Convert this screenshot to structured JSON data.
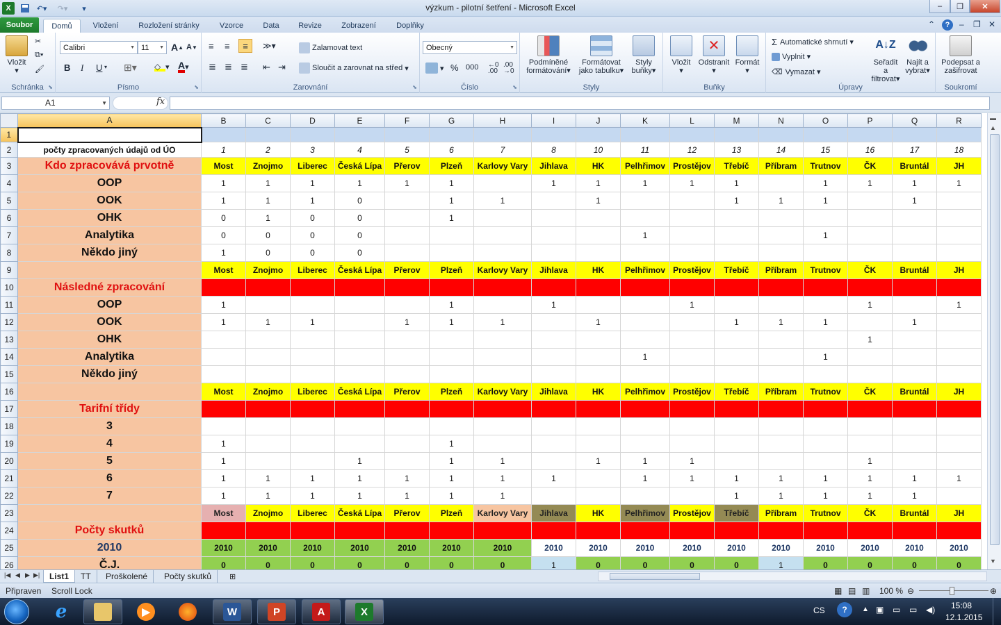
{
  "window": {
    "title": "výzkum - pilotní šetření  -  Microsoft Excel",
    "controls": {
      "minimize": "–",
      "restore": "❐",
      "close": "✕"
    }
  },
  "ribbon_tabs": [
    "Soubor",
    "Domů",
    "Vložení",
    "Rozložení stránky",
    "Vzorce",
    "Data",
    "Revize",
    "Zobrazení",
    "Doplňky"
  ],
  "ribbon": {
    "clipboard": {
      "paste": "Vložit",
      "group": "Schránka"
    },
    "font": {
      "name": "Calibri",
      "size": "11",
      "bold": "B",
      "italic": "I",
      "underline": "U",
      "group": "Písmo",
      "grow": "A",
      "shrink": "A"
    },
    "alignment": {
      "wrap": "Zalamovat text",
      "merge": "Sloučit a zarovnat na střed",
      "group": "Zarovnání"
    },
    "number": {
      "format": "Obecný",
      "percent": "%",
      "thousands": "000",
      "group": "Číslo"
    },
    "styles": {
      "conditional_1": "Podmíněné",
      "conditional_2": "formátování",
      "as_table_1": "Formátovat",
      "as_table_2": "jako tabulku",
      "cell_1": "Styly",
      "cell_2": "buňky",
      "group": "Styly"
    },
    "cells": {
      "insert": "Vložit",
      "delete": "Odstranit",
      "format": "Formát",
      "group": "Buňky"
    },
    "editing": {
      "autosum": "Automatické shrnutí",
      "fill": "Vyplnit",
      "clear": "Vymazat",
      "sort_1": "Seřadit a",
      "sort_2": "filtrovat",
      "find_1": "Najít a",
      "find_2": "vybrat",
      "group": "Úpravy"
    },
    "privacy": {
      "sign_1": "Podepsat a",
      "sign_2": "zašifrovat",
      "group": "Soukromí"
    }
  },
  "formula_bar": {
    "name_box": "A1",
    "fx": "fx",
    "formula": ""
  },
  "columns": [
    "A",
    "B",
    "C",
    "D",
    "E",
    "F",
    "G",
    "H",
    "I",
    "J",
    "K",
    "L",
    "M",
    "N",
    "O",
    "P",
    "Q",
    "R"
  ],
  "cities": [
    "Most",
    "Znojmo",
    "Liberec",
    "Česká Lípa",
    "Přerov",
    "Plzeň",
    "Karlovy Vary",
    "Jihlava",
    "HK",
    "Pelhřimov",
    "Prostějov",
    "Třebíč",
    "Příbram",
    "Trutnov",
    "ČK",
    "Bruntál",
    "JH"
  ],
  "sheet": {
    "row2": {
      "label": "počty zpracovaných údajů od ÚO",
      "values": [
        "1",
        "2",
        "3",
        "4",
        "5",
        "6",
        "7",
        "8",
        "10",
        "11",
        "12",
        "13",
        "14",
        "15",
        "16",
        "17",
        "18"
      ]
    },
    "section1_title": "Kdo zpracovává prvotně",
    "section1_rows": [
      {
        "label": "OOP",
        "values": [
          "1",
          "1",
          "1",
          "1",
          "1",
          "1",
          "",
          "1",
          "1",
          "1",
          "1",
          "1",
          "",
          "1",
          "1",
          "1",
          "1"
        ]
      },
      {
        "label": "OOK",
        "values": [
          "1",
          "1",
          "1",
          "0",
          "",
          "1",
          "1",
          "",
          "1",
          "",
          "",
          "1",
          "1",
          "1",
          "",
          "1",
          ""
        ]
      },
      {
        "label": "OHK",
        "values": [
          "0",
          "1",
          "0",
          "0",
          "",
          "1",
          "",
          "",
          "",
          "",
          "",
          "",
          "",
          "",
          "",
          "",
          ""
        ]
      },
      {
        "label": "Analytika",
        "values": [
          "0",
          "0",
          "0",
          "0",
          "",
          "",
          "",
          "",
          "",
          "1",
          "",
          "",
          "",
          "1",
          "",
          "",
          ""
        ]
      },
      {
        "label": "Někdo jiný",
        "values": [
          "1",
          "0",
          "0",
          "0",
          "",
          "",
          "",
          "",
          "",
          "",
          "",
          "",
          "",
          "",
          "",
          "",
          ""
        ]
      }
    ],
    "section2_title": "Následné zpracování",
    "section2_rows": [
      {
        "label": "OOP",
        "values": [
          "1",
          "",
          "",
          "",
          "",
          "1",
          "",
          "1",
          "",
          "",
          "1",
          "",
          "",
          "",
          "1",
          "",
          "1"
        ]
      },
      {
        "label": "OOK",
        "values": [
          "1",
          "1",
          "1",
          "",
          "1",
          "1",
          "1",
          "",
          "1",
          "",
          "",
          "1",
          "1",
          "1",
          "",
          "1",
          ""
        ]
      },
      {
        "label": "OHK",
        "values": [
          "",
          "",
          "",
          "",
          "",
          "",
          "",
          "",
          "",
          "",
          "",
          "",
          "",
          "",
          "1",
          "",
          ""
        ]
      },
      {
        "label": "Analytika",
        "values": [
          "",
          "",
          "",
          "",
          "",
          "",
          "",
          "",
          "",
          "1",
          "",
          "",
          "",
          "1",
          "",
          "",
          ""
        ]
      },
      {
        "label": "Někdo jiný",
        "values": [
          "",
          "",
          "",
          "",
          "",
          "",
          "",
          "",
          "",
          "",
          "",
          "",
          "",
          "",
          "",
          "",
          ""
        ]
      }
    ],
    "section3_title": "Tarifní třídy",
    "section3_rows": [
      {
        "label": "3",
        "values": [
          "",
          "",
          "",
          "",
          "",
          "",
          "",
          "",
          "",
          "",
          "",
          "",
          "",
          "",
          "",
          "",
          ""
        ]
      },
      {
        "label": "4",
        "values": [
          "1",
          "",
          "",
          "",
          "",
          "1",
          "",
          "",
          "",
          "",
          "",
          "",
          "",
          "",
          "",
          "",
          ""
        ]
      },
      {
        "label": "5",
        "values": [
          "1",
          "",
          "",
          "1",
          "",
          "1",
          "1",
          "",
          "1",
          "1",
          "1",
          "",
          "",
          "",
          "1",
          "",
          ""
        ]
      },
      {
        "label": "6",
        "values": [
          "1",
          "1",
          "1",
          "1",
          "1",
          "1",
          "1",
          "1",
          "",
          "1",
          "1",
          "1",
          "1",
          "1",
          "1",
          "1",
          "1"
        ]
      },
      {
        "label": "7",
        "values": [
          "1",
          "1",
          "1",
          "1",
          "1",
          "1",
          "1",
          "",
          "",
          "",
          "",
          "1",
          "1",
          "1",
          "1",
          "1",
          ""
        ]
      }
    ],
    "section4_title": "Počty skutků",
    "year_row": {
      "label": "2010",
      "values": [
        "2010",
        "2010",
        "2010",
        "2010",
        "2010",
        "2010",
        "2010",
        "2010",
        "2010",
        "2010",
        "2010",
        "2010",
        "2010",
        "2010",
        "2010",
        "2010",
        "2010"
      ]
    },
    "cj_row": {
      "label": "Č.J.",
      "values": [
        "0",
        "0",
        "0",
        "0",
        "0",
        "0",
        "0",
        "1",
        "0",
        "0",
        "0",
        "0",
        "1",
        "0",
        "0",
        "0",
        "0"
      ]
    }
  },
  "sheet_tabs": [
    "List1",
    "TT",
    "Proškolené",
    "Počty skutků"
  ],
  "status": {
    "ready": "Připraven",
    "scroll_lock": "Scroll Lock",
    "zoom": "100 %"
  },
  "taskbar": {
    "lang": "CS",
    "time": "15:08",
    "date": "12.1.2015"
  },
  "colors": {
    "yellow": "#ffff00",
    "red": "#ff0000",
    "peach": "#f7c5a1",
    "green": "#92d050",
    "light_blue": "#c5e0f0",
    "excel_green": "#1d7a2c"
  }
}
